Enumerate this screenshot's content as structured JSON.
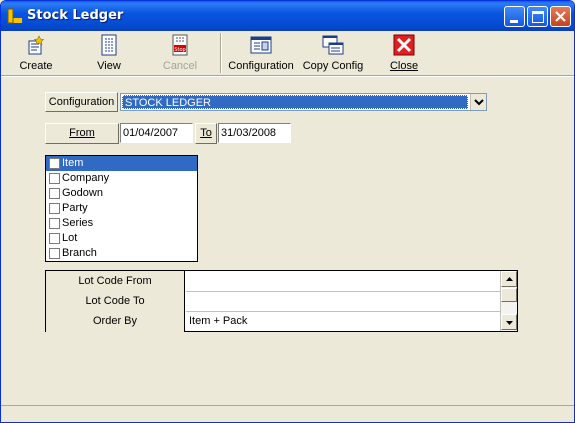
{
  "window": {
    "title": "Stock Ledger"
  },
  "toolbar": {
    "create": "Create",
    "view": "View",
    "cancel": "Cancel",
    "configuration": "Configuration",
    "copy_config": "Copy Config",
    "close": "Close"
  },
  "form": {
    "configuration_label": "Configuration",
    "configuration_value": "STOCK LEDGER",
    "from_label": "From",
    "from_date": "01/04/2007",
    "to_label": "To",
    "to_date": "31/03/2008"
  },
  "options": [
    {
      "label": "Item",
      "selected": true
    },
    {
      "label": "Company",
      "selected": false
    },
    {
      "label": "Godown",
      "selected": false
    },
    {
      "label": "Party",
      "selected": false
    },
    {
      "label": "Series",
      "selected": false
    },
    {
      "label": "Lot",
      "selected": false
    },
    {
      "label": "Branch",
      "selected": false
    }
  ],
  "grid": [
    {
      "label": "Lot Code From",
      "value": ""
    },
    {
      "label": "Lot Code To",
      "value": ""
    },
    {
      "label": "Order By",
      "value": "Item + Pack"
    }
  ],
  "colors": {
    "title_bar": "#0a56e0",
    "selection": "#316ac5",
    "window_bg": "#ece9d8"
  }
}
